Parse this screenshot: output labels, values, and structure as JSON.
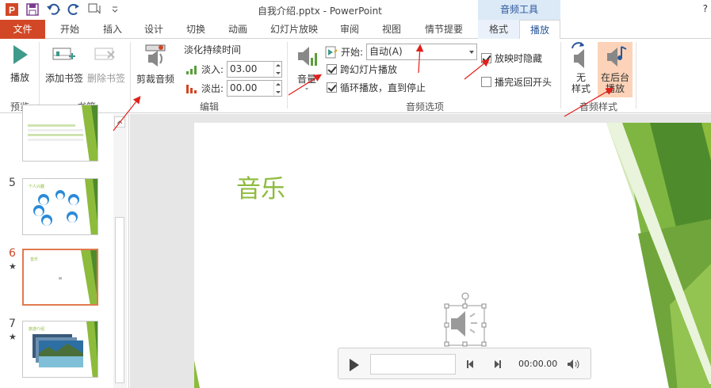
{
  "window": {
    "title": "自我介绍.pptx - PowerPoint",
    "context_title": "音频工具",
    "help": "?"
  },
  "quick_access": {
    "icons": [
      "powerpoint-logo-icon",
      "save-icon",
      "undo-icon",
      "redo-icon",
      "touch-mode-icon",
      "customize-icon"
    ]
  },
  "tabs": [
    "文件",
    "开始",
    "插入",
    "设计",
    "切换",
    "动画",
    "幻灯片放映",
    "审阅",
    "视图",
    "情节提要",
    "格式",
    "播放"
  ],
  "ribbon": {
    "preview": {
      "play_label": "播放",
      "group": "预览"
    },
    "bookmarks": {
      "add_label": "添加书签",
      "remove_label": "删除书签",
      "group": "书签"
    },
    "editing": {
      "trim_label": "剪裁音频",
      "fade_title": "淡化持续时间",
      "fade_in_label": "淡入:",
      "fade_in_value": "03.00",
      "fade_out_label": "淡出:",
      "fade_out_value": "00.00",
      "group": "编辑"
    },
    "audio_options": {
      "volume_label": "音量",
      "start_label": "开始:",
      "start_value": "自动(A)",
      "cross_slides_label": "跨幻灯片播放",
      "loop_label": "循环播放，直到停止",
      "hide_label": "放映时隐藏",
      "rewind_label": "播完返回开头",
      "group": "音频选项",
      "cross_slides_checked": true,
      "loop_checked": true,
      "hide_checked": true,
      "rewind_checked": false
    },
    "audio_styles": {
      "no_style_line1": "无",
      "no_style_line2": "样式",
      "background_line1": "在后台",
      "background_line2": "播放",
      "group": "音频样式"
    }
  },
  "thumbnails": [
    {
      "number": "",
      "star": "",
      "label": ""
    },
    {
      "number": "5",
      "star": "",
      "label": "个人兴趣"
    },
    {
      "number": "6",
      "star": "★",
      "label": "音乐"
    },
    {
      "number": "7",
      "star": "★",
      "label": "旅游介绍"
    }
  ],
  "slide": {
    "title": "音乐"
  },
  "player": {
    "time": "00:00.00"
  },
  "colors": {
    "file_tab": "#d24726",
    "accent_green": "#8dbb3c",
    "dark_green": "#4e8b2c",
    "annotation_red": "#e0201b",
    "highlight": "#fcd3b8"
  }
}
